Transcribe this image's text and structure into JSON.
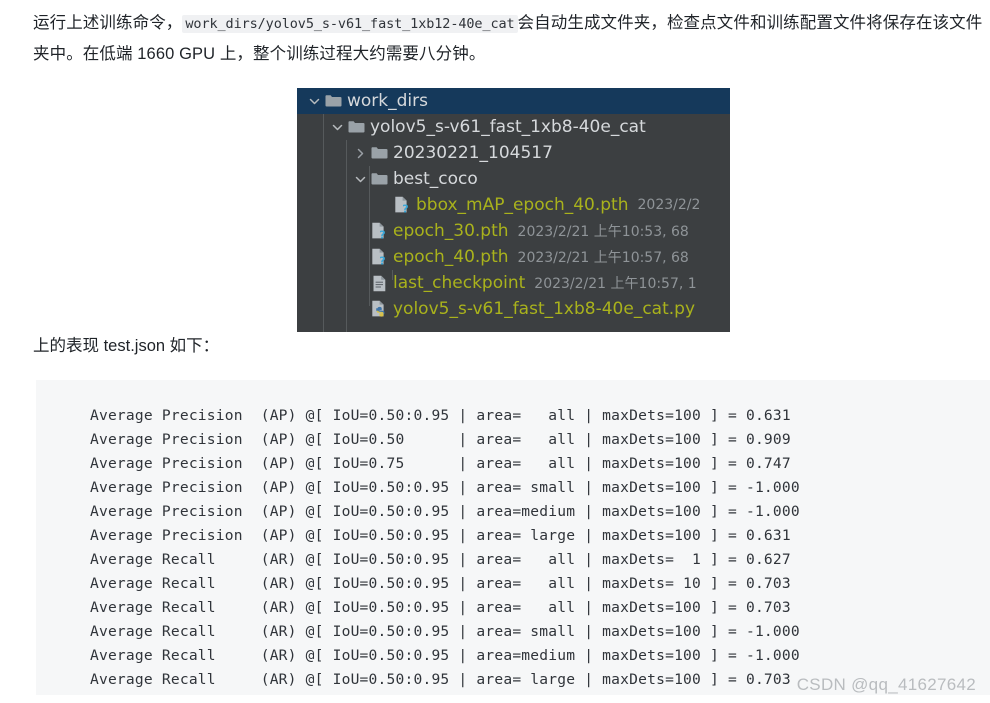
{
  "paragraph": {
    "part1": "运行上述训练命令，",
    "code": "work_dirs/yolov5_s-v61_fast_1xb12-40e_cat",
    "part2": "会自动生成文件夹，检查点文件和训练配置文件将保存在该文件夹中。在低端 1660 GPU 上，整个训练过程大约需要八分钟。"
  },
  "caption": {
    "part1": "上的表现",
    "code": "test.json",
    "part2": "如下："
  },
  "tree": {
    "rows": [
      {
        "name": "work_dirs",
        "kind": "folder",
        "chevron": "chevron-down",
        "depth": 0,
        "selected": true,
        "meta": ""
      },
      {
        "name": "yolov5_s-v61_fast_1xb8-40e_cat",
        "kind": "folder",
        "chevron": "chevron-down",
        "depth": 1,
        "selected": false,
        "meta": ""
      },
      {
        "name": "20230221_104517",
        "kind": "folder",
        "chevron": "chevron-right",
        "depth": 2,
        "selected": false,
        "meta": ""
      },
      {
        "name": "best_coco",
        "kind": "folder",
        "chevron": "chevron-down",
        "depth": 2,
        "selected": false,
        "meta": ""
      },
      {
        "name": "bbox_mAP_epoch_40.pth",
        "kind": "file-pth",
        "chevron": "none",
        "depth": 3,
        "selected": false,
        "meta": "2023/2/2"
      },
      {
        "name": "epoch_30.pth",
        "kind": "file-pth",
        "chevron": "none",
        "depth": 2,
        "selected": false,
        "meta": "2023/2/21 上午10:53, 68"
      },
      {
        "name": "epoch_40.pth",
        "kind": "file-pth",
        "chevron": "none",
        "depth": 2,
        "selected": false,
        "meta": "2023/2/21 上午10:57, 68"
      },
      {
        "name": "last_checkpoint",
        "kind": "file-text",
        "chevron": "none",
        "depth": 2,
        "selected": false,
        "meta": "2023/2/21 上午10:57, 1"
      },
      {
        "name": "yolov5_s-v61_fast_1xb8-40e_cat.py",
        "kind": "file-py",
        "chevron": "none",
        "depth": 2,
        "selected": false,
        "meta": ""
      }
    ]
  },
  "code_output": "  Average Precision  (AP) @[ IoU=0.50:0.95 | area=   all | maxDets=100 ] = 0.631\n  Average Precision  (AP) @[ IoU=0.50      | area=   all | maxDets=100 ] = 0.909\n  Average Precision  (AP) @[ IoU=0.75      | area=   all | maxDets=100 ] = 0.747\n  Average Precision  (AP) @[ IoU=0.50:0.95 | area= small | maxDets=100 ] = -1.000\n  Average Precision  (AP) @[ IoU=0.50:0.95 | area=medium | maxDets=100 ] = -1.000\n  Average Precision  (AP) @[ IoU=0.50:0.95 | area= large | maxDets=100 ] = 0.631\n  Average Recall     (AR) @[ IoU=0.50:0.95 | area=   all | maxDets=  1 ] = 0.627\n  Average Recall     (AR) @[ IoU=0.50:0.95 | area=   all | maxDets= 10 ] = 0.703\n  Average Recall     (AR) @[ IoU=0.50:0.95 | area=   all | maxDets=100 ] = 0.703\n  Average Recall     (AR) @[ IoU=0.50:0.95 | area= small | maxDets=100 ] = -1.000\n  Average Recall     (AR) @[ IoU=0.50:0.95 | area=medium | maxDets=100 ] = -1.000\n  Average Recall     (AR) @[ IoU=0.50:0.95 | area= large | maxDets=100 ] = 0.703",
  "watermark": "CSDN @qq_41627642",
  "colors": {
    "panel_bg": "#3c3f41",
    "row_selected": "#15395b",
    "folder_text": "#d6d9dc",
    "file_text": "#a9b21c",
    "meta_text": "#8f9498",
    "code_bg": "#f6f7f8"
  }
}
